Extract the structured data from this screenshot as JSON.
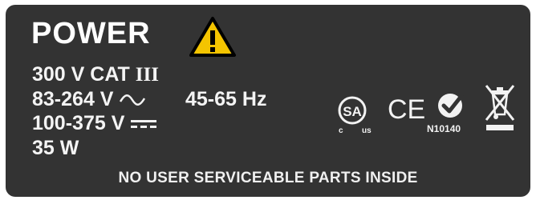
{
  "title": "POWER",
  "specs": {
    "cat": "300 V CAT",
    "cat_roman": "III",
    "ac_range": "83-264 V",
    "frequency": "45-65 Hz",
    "dc_range": "100-375 V",
    "power": "35 W"
  },
  "certifications": {
    "csa_letters": "SA",
    "csa_c": "c",
    "csa_us": "us",
    "ce": "CE",
    "nrtl_code": "N10140"
  },
  "footer": "NO USER SERVICEABLE PARTS INSIDE",
  "icons": {
    "warning": "warning-triangle-icon",
    "ac": "alternating-current-icon",
    "dc": "direct-current-icon",
    "weee": "crossed-bin-icon"
  },
  "colors": {
    "plate": "#333333",
    "text": "#f2f2f2",
    "warning_fill": "#f4c400"
  }
}
